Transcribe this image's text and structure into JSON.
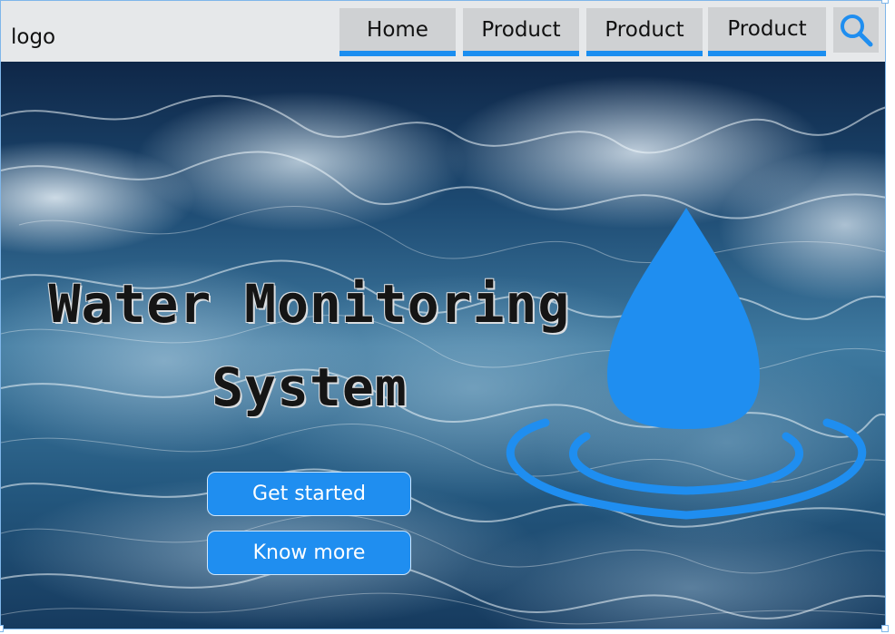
{
  "header": {
    "logo": "logo",
    "nav": [
      {
        "label": "Home"
      },
      {
        "label": "Product"
      },
      {
        "label": "Product"
      },
      {
        "label": "Product"
      }
    ],
    "search_icon": "search-icon"
  },
  "hero": {
    "title_line1": "Water Monitoring",
    "title_line2": "System",
    "get_started": "Get started",
    "know_more": "Know more",
    "graphic": "water-drop-icon"
  },
  "colors": {
    "accent": "#1f8ef0",
    "header_bg": "#e6e8ea",
    "tab_bg": "#cfd1d3",
    "title": "#151515"
  }
}
